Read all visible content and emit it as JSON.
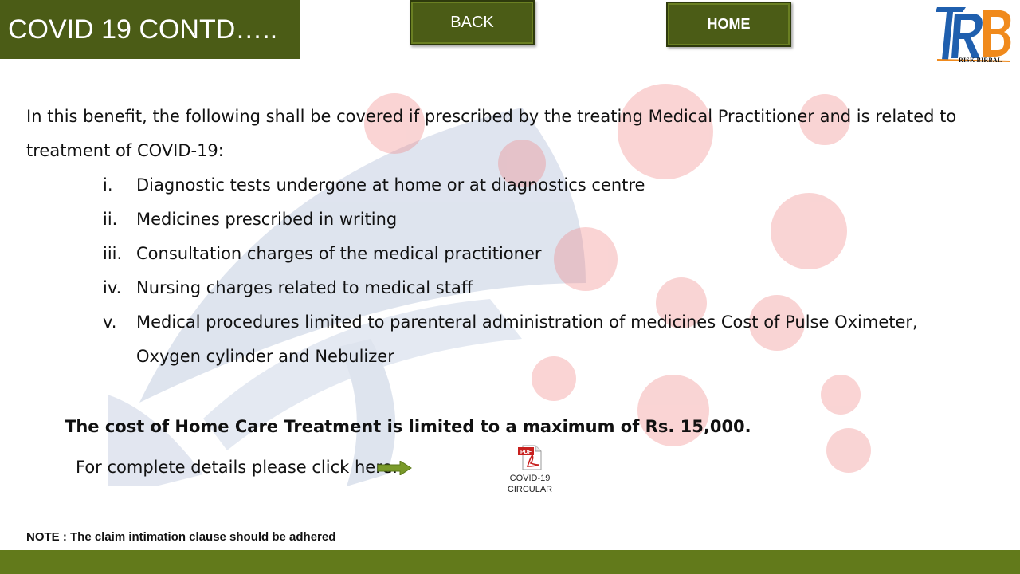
{
  "header": {
    "title": "COVID 19 CONTD…..",
    "back_label": "BACK",
    "home_label": "HOME"
  },
  "logo": {
    "caption": "RISK BIRBAL",
    "icon": "rb-logo-icon"
  },
  "content": {
    "intro": "In this benefit, the following shall be covered if prescribed by the treating Medical Practitioner and is related to treatment of COVID-19:",
    "items": [
      {
        "num": "i.",
        "text": "Diagnostic tests undergone at home or at diagnostics centre"
      },
      {
        "num": "ii.",
        "text": "Medicines prescribed in writing"
      },
      {
        "num": "iii.",
        "text": "Consultation charges of the medical practitioner"
      },
      {
        "num": "iv.",
        "text": "Nursing charges related to medical staff"
      },
      {
        "num": "v.",
        "text": "Medical procedures limited to parenteral administration of medicines Cost of Pulse Oximeter, Oxygen cylinder and Nebulizer"
      }
    ],
    "limit": "The cost of Home Care Treatment is limited to a maximum of Rs. 15,000.",
    "details": "For complete details please click here."
  },
  "attachment": {
    "label_line1": "COVID-19",
    "label_line2": "CIRCULAR",
    "badge": "PDF",
    "icon": "pdf-file-icon"
  },
  "note": "NOTE : The claim intimation clause should be adhered",
  "colors": {
    "title_bg": "#4b5c16",
    "footer_bar": "#627a1b",
    "arrow": "#7a9a2a",
    "logo_blue": "#1f5fae",
    "logo_orange": "#f08a1c"
  }
}
